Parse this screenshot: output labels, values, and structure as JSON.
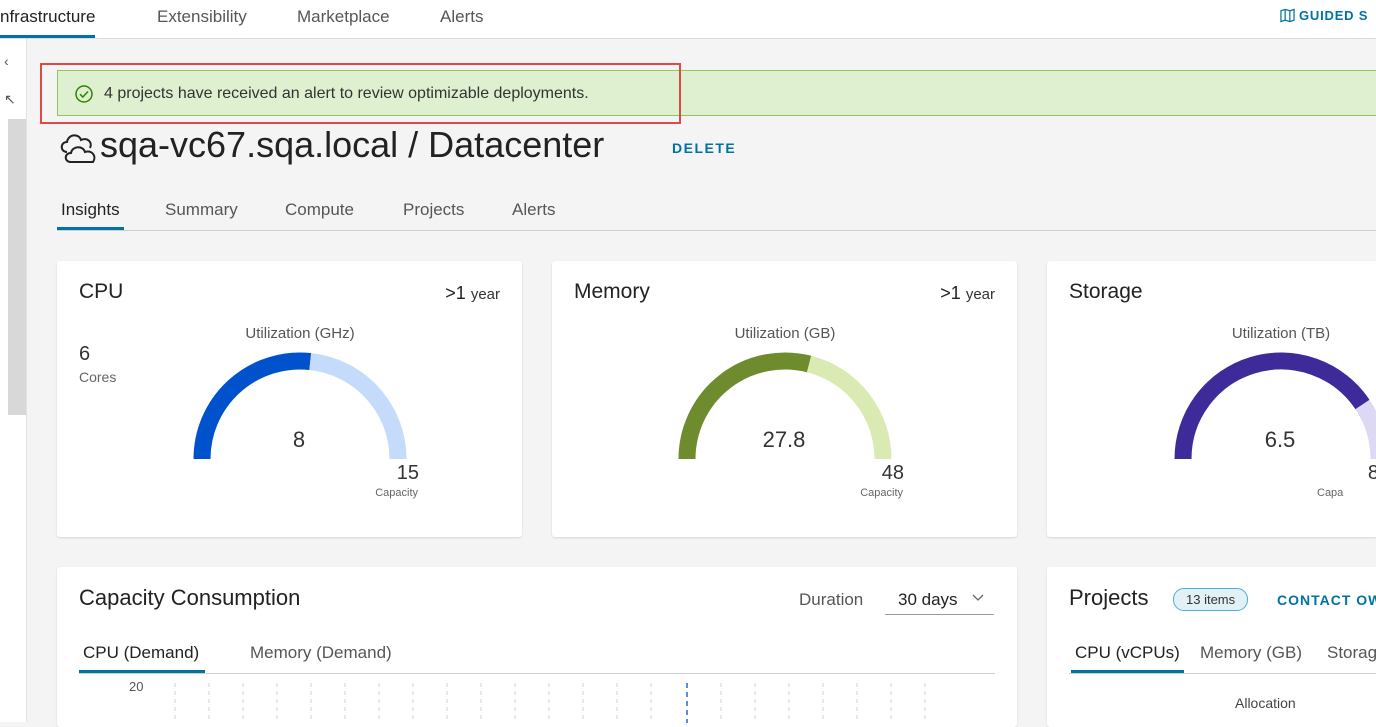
{
  "topnav": {
    "tabs": [
      "nfrastructure",
      "Extensibility",
      "Marketplace",
      "Alerts"
    ],
    "active": "nfrastructure",
    "guided_label": "GUIDED S"
  },
  "alert": {
    "message": "4 projects have received an alert to review optimizable deployments.",
    "type": "success"
  },
  "page": {
    "title": "sqa-vc67.sqa.local / Datacenter",
    "delete_label": "DELETE",
    "tabs": [
      "Insights",
      "Summary",
      "Compute",
      "Projects",
      "Alerts"
    ],
    "active_tab": "Insights"
  },
  "cards": {
    "cpu": {
      "title": "CPU",
      "period_num": ">1",
      "period_unit": "year",
      "cores_value": "6",
      "cores_label": "Cores",
      "util_label": "Utilization (GHz)",
      "value": "8",
      "capacity": "15",
      "capacity_label": "Capacity",
      "fraction": 0.5333,
      "colors": {
        "used": "#0052cc",
        "free": "#c4dbfb"
      }
    },
    "memory": {
      "title": "Memory",
      "period_num": ">1",
      "period_unit": "year",
      "util_label": "Utilization (GB)",
      "value": "27.8",
      "capacity": "48",
      "capacity_label": "Capacity",
      "fraction": 0.579,
      "colors": {
        "used": "#6e8b2d",
        "free": "#d9ebb3"
      }
    },
    "storage": {
      "title": "Storage",
      "util_label": "Utilization (TB)",
      "value": "6.5",
      "capacity": "8",
      "capacity_label": "Capa",
      "fraction": 0.8125,
      "colors": {
        "used": "#3f2a99",
        "free": "#ddd9f5"
      }
    }
  },
  "capacity": {
    "title": "Capacity Consumption",
    "duration_label": "Duration",
    "duration_value": "30 days",
    "tabs": [
      "CPU (Demand)",
      "Memory (Demand)"
    ],
    "active_tab": "CPU (Demand)",
    "y_tick": "20"
  },
  "projects": {
    "title": "Projects",
    "badge": "13 items",
    "contact_label": "CONTACT OW",
    "tabs": [
      "CPU (vCPUs)",
      "Memory (GB)",
      "Storag"
    ],
    "active_tab": "CPU (vCPUs)",
    "allocation_label": "Allocation"
  }
}
